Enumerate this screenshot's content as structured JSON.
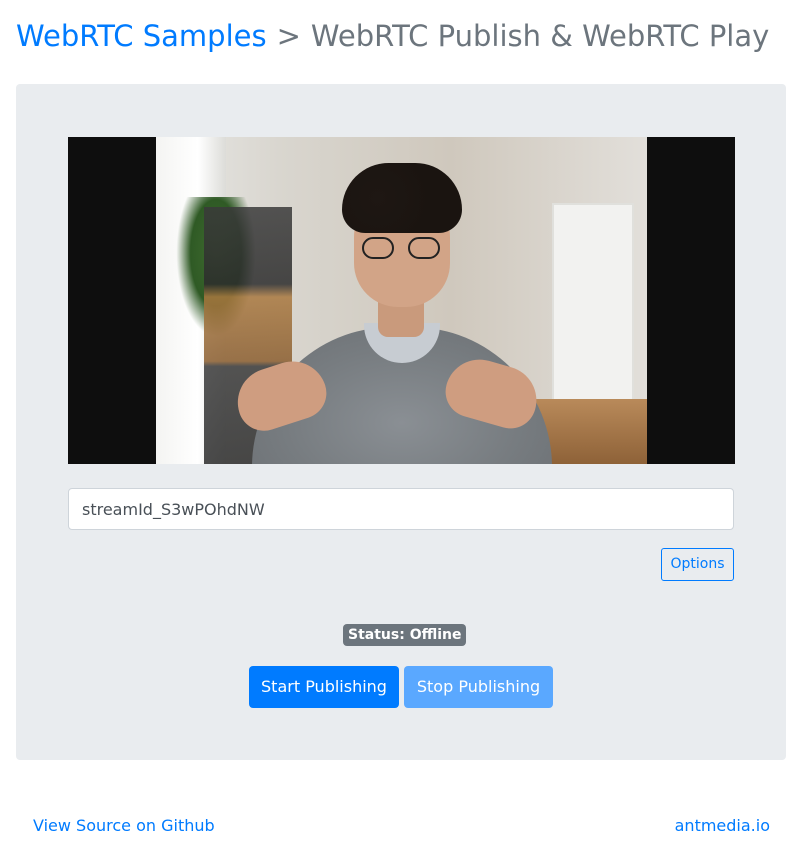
{
  "header": {
    "breadcrumb_root": "WebRTC Samples",
    "separator": ">",
    "page_title": "WebRTC Publish & WebRTC Play"
  },
  "publish": {
    "stream_id_value": "streamId_S3wPOhdNW",
    "options_label": "Options",
    "status_text": "Status: Offline",
    "start_label": "Start Publishing",
    "stop_label": "Stop Publishing"
  },
  "footer": {
    "source_link": "View Source on Github",
    "site_link": "antmedia.io"
  },
  "colors": {
    "link": "#007bff",
    "panel_bg": "#e9ecef",
    "badge_bg": "#6c757d",
    "primary_button": "#007bff",
    "disabled_button": "#5aa8ff"
  }
}
